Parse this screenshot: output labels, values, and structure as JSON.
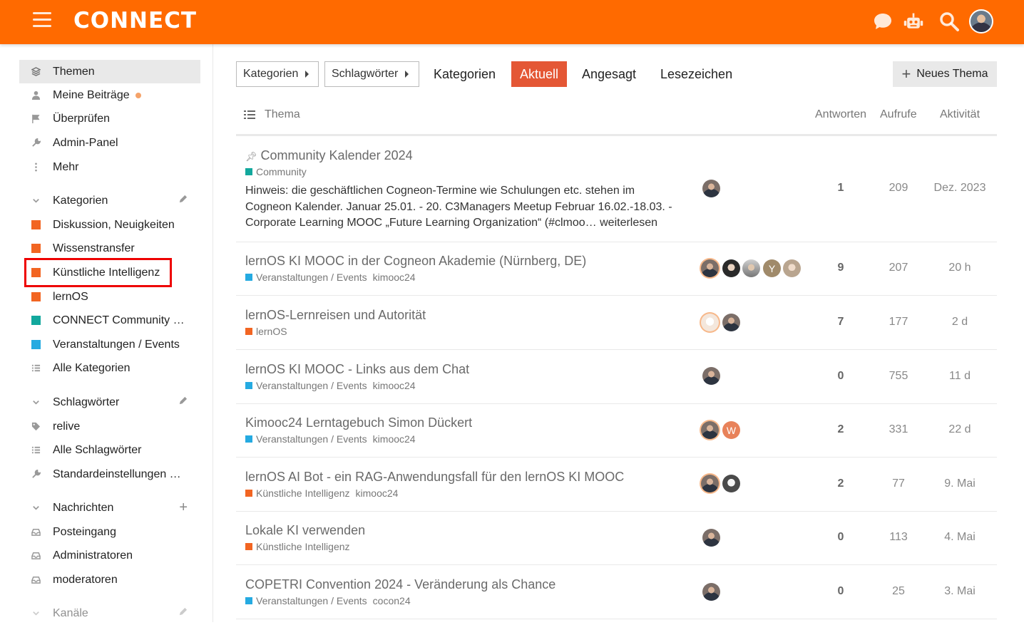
{
  "header": {
    "logo": "CONNECT",
    "icons": [
      "chat-icon",
      "robot-icon",
      "search-icon",
      "user-avatar"
    ],
    "brand_color": "#ff6a00"
  },
  "sidebar": {
    "top_items": [
      {
        "label": "Themen",
        "icon": "topics-icon"
      },
      {
        "label": "Meine Beiträge",
        "icon": "user-icon"
      },
      {
        "label": "Überprüfen",
        "icon": "flag-icon"
      },
      {
        "label": "Admin-Panel",
        "icon": "wrench-icon"
      },
      {
        "label": "Mehr",
        "icon": "more-icon"
      }
    ],
    "categories_title": "Kategorien",
    "categories": [
      {
        "label": "Diskussion, Neuigkeiten",
        "color": "#f26522"
      },
      {
        "label": "Wissenstransfer",
        "color": "#f26522"
      },
      {
        "label": "Künstliche Intelligenz",
        "color": "#f26522"
      },
      {
        "label": "lernOS",
        "color": "#f26522"
      },
      {
        "label": "CONNECT Community …",
        "color": "#12a89d"
      },
      {
        "label": "Veranstaltungen / Events",
        "color": "#25aae1"
      },
      {
        "label": "Alle Kategorien",
        "color": ""
      }
    ],
    "tags_title": "Schlagwörter",
    "tags": [
      {
        "label": "relive",
        "icon": "tag-icon"
      },
      {
        "label": "Alle Schlagwörter",
        "icon": "list-icon"
      },
      {
        "label": "Standardeinstellungen …",
        "icon": "wrench-icon"
      }
    ],
    "messages_title": "Nachrichten",
    "messages": [
      {
        "label": "Posteingang",
        "icon": "inbox-icon"
      },
      {
        "label": "Administratoren",
        "icon": "inbox-icon"
      },
      {
        "label": "moderatoren",
        "icon": "inbox-icon"
      }
    ],
    "channels_title": "Kanäle"
  },
  "main": {
    "filter_categories": "Kategorien",
    "filter_tags": "Schlagwörter",
    "tabs": [
      "Kategorien",
      "Aktuell",
      "Angesagt",
      "Lesezeichen"
    ],
    "active_tab": "Aktuell",
    "new_topic": "Neues Thema",
    "columns": {
      "topic": "Thema",
      "replies": "Antworten",
      "views": "Aufrufe",
      "activity": "Aktivität"
    },
    "topics": [
      {
        "title": "Community Kalender 2024",
        "pinned": true,
        "category": "Community",
        "cat_color": "#12a89d",
        "tags": [],
        "excerpt": "Hinweis: die geschäftlichen Cogneon-Termine wie Schulungen etc. stehen im Cogneon Kalender. Januar 25.01. - 20. C3Managers Meetup Februar 16.02.-18.03. - Corporate Learning MOOC „Future Learning Organization“ (#clmoo…",
        "read_more": "weiterlesen",
        "replies": "1",
        "views": "209",
        "activity": "Dez. 2023"
      },
      {
        "title": "lernOS KI MOOC in der Cogneon Akademie (Nürnberg, DE)",
        "category": "Veranstaltungen / Events",
        "cat_color": "#25aae1",
        "tags": [
          "kimooc24"
        ],
        "replies": "9",
        "views": "207",
        "activity": "20 h"
      },
      {
        "title": "lernOS-Lernreisen und Autorität",
        "category": "lernOS",
        "cat_color": "#f26522",
        "tags": [],
        "replies": "7",
        "views": "177",
        "activity": "2 d"
      },
      {
        "title": "lernOS KI MOOC - Links aus dem Chat",
        "category": "Veranstaltungen / Events",
        "cat_color": "#25aae1",
        "tags": [
          "kimooc24"
        ],
        "replies": "0",
        "views": "755",
        "activity": "11 d"
      },
      {
        "title": "Kimooc24 Lerntagebuch Simon Dückert",
        "category": "Veranstaltungen / Events",
        "cat_color": "#25aae1",
        "tags": [
          "kimooc24"
        ],
        "replies": "2",
        "views": "331",
        "activity": "22 d"
      },
      {
        "title": "lernOS AI Bot - ein RAG-Anwendungsfall für den lernOS KI MOOC",
        "category": "Künstliche Intelligenz",
        "cat_color": "#f26522",
        "tags": [
          "kimooc24"
        ],
        "replies": "2",
        "views": "77",
        "activity": "9. Mai"
      },
      {
        "title": "Lokale KI verwenden",
        "category": "Künstliche Intelligenz",
        "cat_color": "#f26522",
        "tags": [],
        "replies": "0",
        "views": "113",
        "activity": "4. Mai"
      },
      {
        "title": "COPETRI Convention 2024 - Veränderung als Chance",
        "category": "Veranstaltungen / Events",
        "cat_color": "#25aae1",
        "tags": [
          "cocon24"
        ],
        "replies": "0",
        "views": "25",
        "activity": "3. Mai"
      }
    ],
    "avatar_letters": {
      "y": "Y",
      "w": "W"
    }
  }
}
